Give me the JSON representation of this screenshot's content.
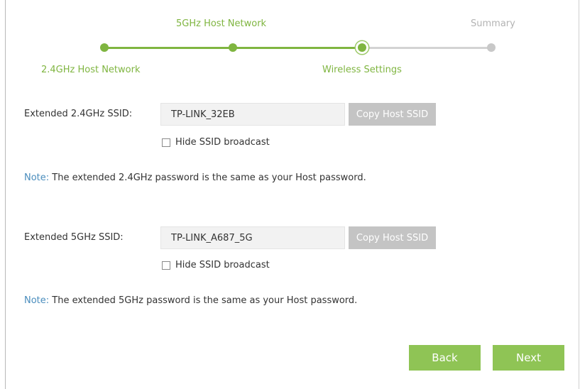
{
  "stepper": {
    "steps": [
      {
        "label": "2.4GHz Host Network",
        "state": "done"
      },
      {
        "label": "5GHz Host Network",
        "state": "done"
      },
      {
        "label": "Wireless Settings",
        "state": "current"
      },
      {
        "label": "Summary",
        "state": "todo"
      }
    ]
  },
  "band24": {
    "label": "Extended 2.4GHz SSID:",
    "ssid_value": "TP-LINK_32EB",
    "copy_button": "Copy Host SSID",
    "hide_label": "Hide SSID broadcast",
    "hide_checked": false,
    "note_key": "Note:",
    "note_text": "The extended 2.4GHz password is the same as your Host password."
  },
  "band5": {
    "label": "Extended 5GHz SSID:",
    "ssid_value": "TP-LINK_A687_5G",
    "copy_button": "Copy Host SSID",
    "hide_label": "Hide SSID broadcast",
    "hide_checked": false,
    "note_key": "Note:",
    "note_text": "The extended 5GHz password is the same as your Host password."
  },
  "actions": {
    "back": "Back",
    "next": "Next"
  },
  "colors": {
    "accent_green": "#7fb540",
    "button_green": "#8fc455",
    "note_blue": "#4a8dbd",
    "disabled_gray": "#c4c4c4"
  }
}
